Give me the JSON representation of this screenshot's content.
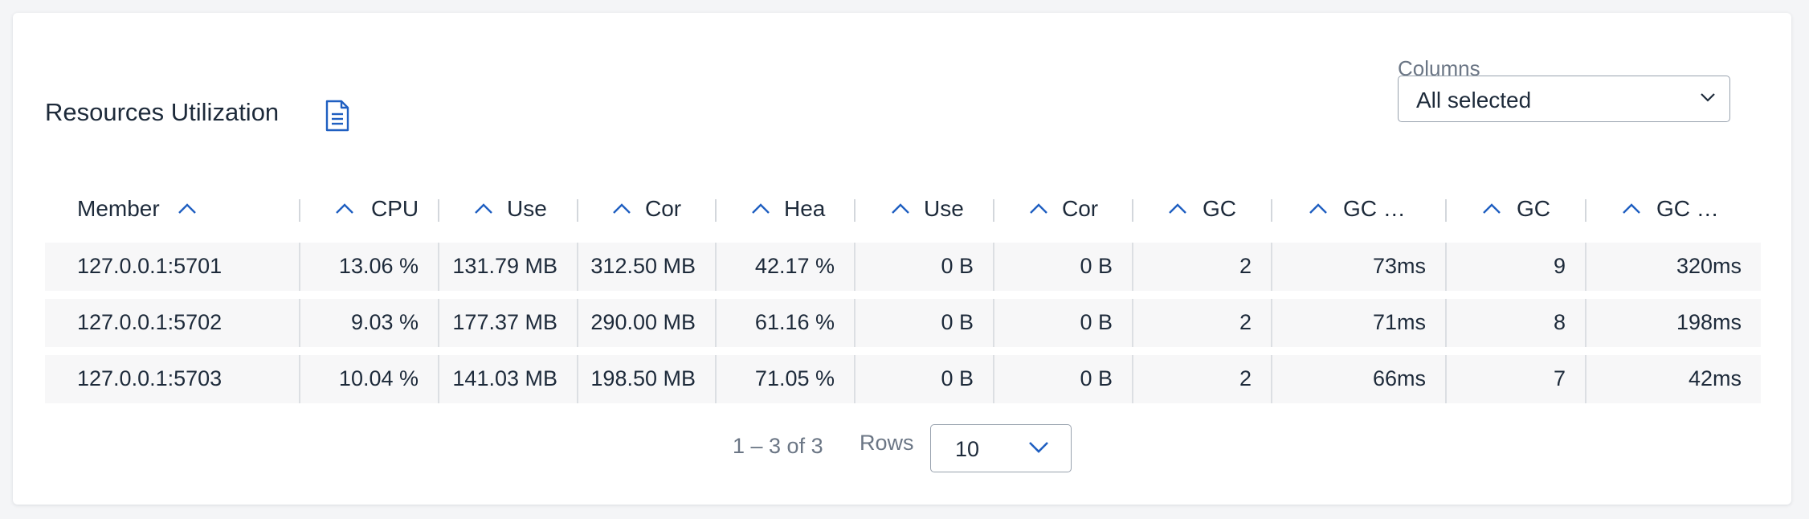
{
  "title": "Resources Utilization",
  "icons": {
    "report": "document-icon",
    "sort": "chevron-up-icon",
    "dropdown": "chevron-down-icon"
  },
  "accent_color": "#1f5fc1",
  "columns_filter": {
    "label": "Columns",
    "value": "All selected"
  },
  "table": {
    "headers": [
      "Member",
      "CPU",
      "Use",
      "Cor",
      "Hea",
      "Use",
      "Cor",
      "GC",
      "GC …",
      "GC",
      "GC …"
    ],
    "rows": [
      [
        "127.0.0.1:5701",
        "13.06 %",
        "131.79 MB",
        "312.50 MB",
        "42.17 %",
        "0 B",
        "0 B",
        "2",
        "73ms",
        "9",
        "320ms"
      ],
      [
        "127.0.0.1:5702",
        "9.03 %",
        "177.37 MB",
        "290.00 MB",
        "61.16 %",
        "0 B",
        "0 B",
        "2",
        "71ms",
        "8",
        "198ms"
      ],
      [
        "127.0.0.1:5703",
        "10.04 %",
        "141.03 MB",
        "198.50 MB",
        "71.05 %",
        "0 B",
        "0 B",
        "2",
        "66ms",
        "7",
        "42ms"
      ]
    ]
  },
  "pagination": {
    "range": "1 – 3 of 3",
    "rows_label": "Rows",
    "rows_value": "10"
  }
}
